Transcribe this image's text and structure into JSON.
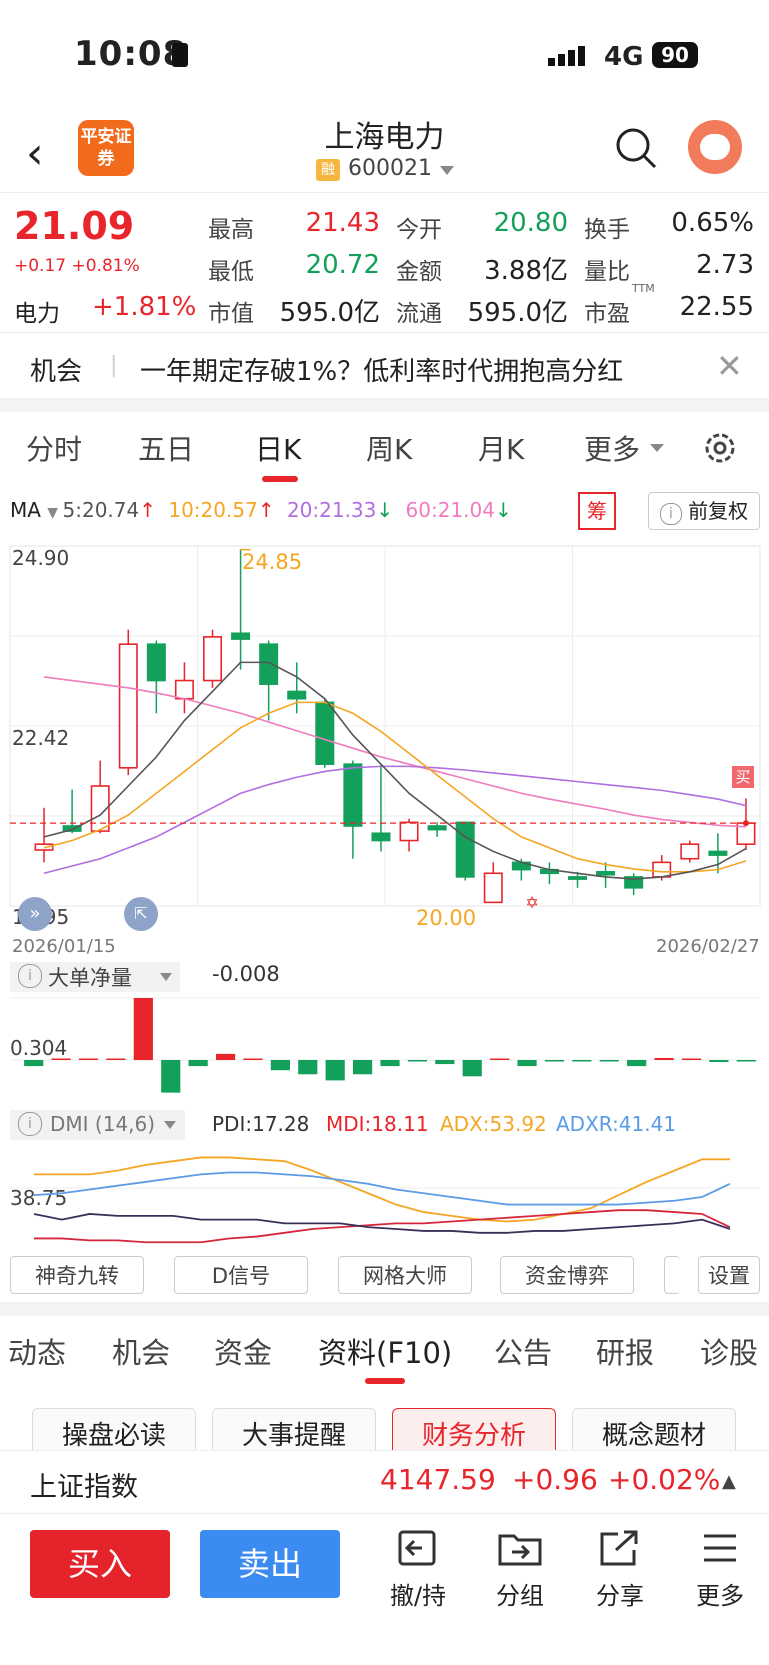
{
  "status_bar": {
    "time": "10:08",
    "network": "4G",
    "battery": "90"
  },
  "header": {
    "logo_text": "平安证券",
    "title": "上海电力",
    "badge": "融",
    "code": "600021"
  },
  "quote": {
    "price": "21.09",
    "change": "+0.17 +0.81%",
    "sector_label": "电力",
    "sector_change": "+1.81%",
    "fields": [
      {
        "label": "最高",
        "value": "21.43",
        "color": "red"
      },
      {
        "label": "今开",
        "value": "20.80",
        "color": "green"
      },
      {
        "label": "换手",
        "value": "0.65%",
        "color": "black"
      },
      {
        "label": "最低",
        "value": "20.72",
        "color": "green"
      },
      {
        "label": "金额",
        "value": "3.88亿",
        "color": "black"
      },
      {
        "label": "量比",
        "value": "2.73",
        "color": "black"
      },
      {
        "label": "市值",
        "value": "595.0亿",
        "color": "black"
      },
      {
        "label": "流通",
        "value": "595.0亿",
        "color": "black"
      },
      {
        "label": "市盈",
        "value": "22.55",
        "color": "black"
      }
    ],
    "pe_suffix": "TTM"
  },
  "news": {
    "tag": "机会",
    "text": "一年期定存破1%？低利率时代拥抱高分红"
  },
  "period_tabs": [
    "分时",
    "五日",
    "日K",
    "周K",
    "月K",
    "更多"
  ],
  "ma_legend": {
    "label": "MA",
    "ma5": "5:20.74",
    "ma10": "10:20.57",
    "ma20": "20:21.33",
    "ma60": "60:21.04",
    "chou": "筹",
    "fuquan": "前复权"
  },
  "kline": {
    "y_top": "24.90",
    "y_mid": "22.42",
    "y_bottom": "19.95",
    "high_label": "24.85",
    "low_label": "20.00",
    "date_start": "2026/01/15",
    "date_end": "2026/02/27",
    "buy_marker": "买",
    "candles": [
      {
        "o": 20.72,
        "c": 20.8,
        "h": 21.3,
        "l": 20.55
      },
      {
        "o": 21.05,
        "c": 20.98,
        "h": 21.55,
        "l": 20.95
      },
      {
        "o": 20.98,
        "c": 21.6,
        "h": 21.95,
        "l": 20.95
      },
      {
        "o": 21.85,
        "c": 23.55,
        "h": 23.75,
        "l": 21.75
      },
      {
        "o": 23.55,
        "c": 23.05,
        "h": 23.6,
        "l": 22.6
      },
      {
        "o": 22.8,
        "c": 23.05,
        "h": 23.3,
        "l": 22.6
      },
      {
        "o": 23.05,
        "c": 23.65,
        "h": 23.75,
        "l": 22.95
      },
      {
        "o": 23.7,
        "c": 23.62,
        "h": 24.85,
        "l": 23.2
      },
      {
        "o": 23.55,
        "c": 23.0,
        "h": 23.6,
        "l": 22.5
      },
      {
        "o": 22.9,
        "c": 22.8,
        "h": 23.3,
        "l": 22.6
      },
      {
        "o": 22.75,
        "c": 21.9,
        "h": 22.8,
        "l": 21.85
      },
      {
        "o": 21.9,
        "c": 21.05,
        "h": 21.95,
        "l": 20.6
      },
      {
        "o": 20.95,
        "c": 20.85,
        "h": 21.9,
        "l": 20.7
      },
      {
        "o": 20.85,
        "c": 21.1,
        "h": 21.15,
        "l": 20.7
      },
      {
        "o": 21.05,
        "c": 21.0,
        "h": 21.1,
        "l": 20.9
      },
      {
        "o": 21.1,
        "c": 20.35,
        "h": 21.1,
        "l": 20.3
      },
      {
        "o": 20.0,
        "c": 20.4,
        "h": 20.55,
        "l": 20.0
      },
      {
        "o": 20.55,
        "c": 20.45,
        "h": 20.6,
        "l": 20.3
      },
      {
        "o": 20.45,
        "c": 20.4,
        "h": 20.55,
        "l": 20.25
      },
      {
        "o": 20.35,
        "c": 20.32,
        "h": 20.42,
        "l": 20.2
      },
      {
        "o": 20.42,
        "c": 20.38,
        "h": 20.55,
        "l": 20.2
      },
      {
        "o": 20.35,
        "c": 20.2,
        "h": 20.4,
        "l": 20.1
      },
      {
        "o": 20.35,
        "c": 20.55,
        "h": 20.65,
        "l": 20.3
      },
      {
        "o": 20.6,
        "c": 20.8,
        "h": 20.85,
        "l": 20.55
      },
      {
        "o": 20.7,
        "c": 20.65,
        "h": 20.95,
        "l": 20.4
      },
      {
        "o": 20.8,
        "c": 21.09,
        "h": 21.43,
        "l": 20.72
      }
    ],
    "ma5": [
      20.9,
      21.0,
      21.2,
      21.6,
      22.0,
      22.5,
      22.9,
      23.3,
      23.3,
      23.1,
      22.8,
      22.3,
      21.9,
      21.5,
      21.2,
      20.9,
      20.7,
      20.55,
      20.45,
      20.4,
      20.35,
      20.32,
      20.35,
      20.42,
      20.52,
      20.74
    ],
    "ma10": [
      20.75,
      20.85,
      21.0,
      21.2,
      21.5,
      21.8,
      22.1,
      22.4,
      22.6,
      22.75,
      22.75,
      22.6,
      22.35,
      22.05,
      21.75,
      21.45,
      21.15,
      20.9,
      20.75,
      20.6,
      20.52,
      20.46,
      20.42,
      20.42,
      20.45,
      20.57
    ],
    "ma20": [
      20.4,
      20.5,
      20.6,
      20.75,
      20.9,
      21.1,
      21.3,
      21.5,
      21.62,
      21.72,
      21.8,
      21.85,
      21.87,
      21.87,
      21.85,
      21.82,
      21.78,
      21.74,
      21.7,
      21.66,
      21.62,
      21.58,
      21.54,
      21.48,
      21.42,
      21.33
    ],
    "ma60": [
      23.1,
      23.05,
      23.0,
      22.95,
      22.88,
      22.8,
      22.7,
      22.6,
      22.48,
      22.36,
      22.24,
      22.12,
      22.0,
      21.9,
      21.8,
      21.7,
      21.6,
      21.5,
      21.42,
      21.35,
      21.28,
      21.2,
      21.14,
      21.1,
      21.06,
      21.04
    ]
  },
  "big_order": {
    "title": "大单净量",
    "value": "-0.008",
    "y_label": "0.304",
    "bars": [
      -0.03,
      0,
      0,
      0,
      0.304,
      -0.16,
      -0.03,
      0.03,
      0.005,
      -0.05,
      -0.07,
      -0.1,
      -0.07,
      -0.03,
      -0.005,
      -0.02,
      -0.08,
      0.005,
      -0.03,
      -0.005,
      -0.005,
      -0.005,
      -0.03,
      0.01,
      0.005,
      -0.01,
      -0.005
    ]
  },
  "dmi": {
    "title": "DMI (14,6)",
    "pdi": "PDI:17.28",
    "mdi": "MDI:18.11",
    "adx": "ADX:53.92",
    "adxr": "ADXR:41.41",
    "y_label": "38.75",
    "pdi_series": [
      25,
      22,
      25,
      24,
      24,
      24,
      22,
      22,
      22,
      20,
      20,
      20,
      18,
      17,
      16,
      16,
      15,
      15,
      16,
      16,
      17,
      18,
      19,
      20,
      22,
      17
    ],
    "mdi_series": [
      12,
      12,
      11,
      11,
      10,
      10,
      10,
      12,
      13,
      15,
      17,
      18,
      19,
      20,
      20,
      21,
      22,
      23,
      24,
      25,
      26,
      27,
      27,
      26,
      25,
      18
    ],
    "adx_series": [
      46,
      46,
      46,
      48,
      51,
      53,
      55,
      55,
      54,
      53,
      48,
      42,
      36,
      30,
      26,
      24,
      22,
      21,
      22,
      25,
      28,
      35,
      42,
      48,
      54,
      54
    ],
    "adxr_series": [
      35,
      36,
      38,
      40,
      42,
      44,
      46,
      47,
      47,
      46,
      45,
      43,
      41,
      38,
      36,
      34,
      32,
      30,
      30,
      30,
      30,
      30,
      31,
      32,
      34,
      41
    ]
  },
  "tools": [
    "神奇九转",
    "D信号",
    "网格大师",
    "资金博弈",
    "设置"
  ],
  "bottom_tabs": [
    "动态",
    "机会",
    "资金",
    "资料(F10)",
    "公告",
    "研报",
    "诊股"
  ],
  "chips": [
    "操盘必读",
    "大事提醒",
    "财务分析",
    "概念题材"
  ],
  "index": {
    "name": "上证指数",
    "value": "4147.59",
    "change": "+0.96",
    "pct": "+0.02%"
  },
  "actions": {
    "buy": "买入",
    "sell": "卖出",
    "cancel": "撤/持",
    "group": "分组",
    "share": "分享",
    "more": "更多"
  },
  "colors": {
    "up": "#e8252a",
    "down": "#12a05b",
    "ma5": "#555555",
    "ma10": "#f5a623",
    "ma20": "#b06ee0",
    "ma60": "#f07bbf",
    "adxr": "#5b9be8"
  }
}
